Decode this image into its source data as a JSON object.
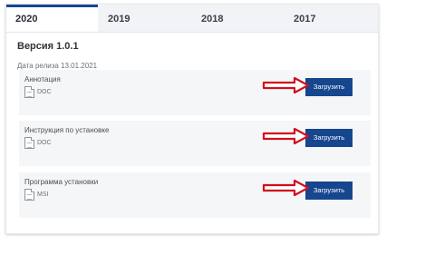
{
  "tabs": [
    {
      "label": "2020",
      "active": true
    },
    {
      "label": "2019",
      "active": false
    },
    {
      "label": "2018",
      "active": false
    },
    {
      "label": "2017",
      "active": false
    }
  ],
  "release": {
    "version": "Версия 1.0.1",
    "date": "Дата релиза 13.01.2021"
  },
  "files": [
    {
      "title": "Аннотация",
      "type": "DOC",
      "button": "Загрузить"
    },
    {
      "title": "Инструкция по установке",
      "type": "DOC",
      "button": "Загрузить"
    },
    {
      "title": "Программа установки",
      "type": "MSI",
      "button": "Загрузить"
    }
  ],
  "colors": {
    "accent": "#16468e",
    "annotation_arrow": "#d0101b"
  },
  "icons": [
    "file-doc-icon",
    "file-msi-icon",
    "red-arrow-annotation"
  ]
}
